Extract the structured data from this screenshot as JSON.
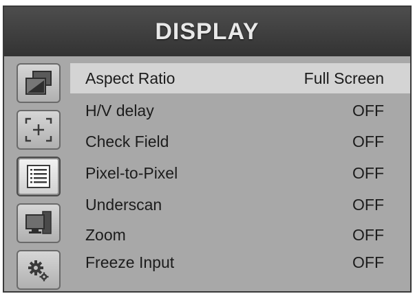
{
  "header": {
    "title": "DISPLAY"
  },
  "sidebar": {
    "items": [
      {
        "icon": "picture-icon"
      },
      {
        "icon": "crosshair-marker-icon"
      },
      {
        "icon": "list-menu-icon"
      },
      {
        "icon": "monitor-icon"
      },
      {
        "icon": "gear-icon"
      }
    ],
    "active_index": 2
  },
  "menu": {
    "items": [
      {
        "label": "Aspect Ratio",
        "value": "Full Screen"
      },
      {
        "label": "H/V delay",
        "value": "OFF"
      },
      {
        "label": "Check Field",
        "value": "OFF"
      },
      {
        "label": "Pixel-to-Pixel",
        "value": "OFF"
      },
      {
        "label": "Underscan",
        "value": "OFF"
      },
      {
        "label": "Zoom",
        "value": "OFF"
      },
      {
        "label": "Freeze Input",
        "value": "OFF"
      }
    ],
    "selected_index": 0
  },
  "colors": {
    "panel": "#a8a8a8",
    "header": "#3d3d3d",
    "selected_row": "#d4d4d4"
  }
}
